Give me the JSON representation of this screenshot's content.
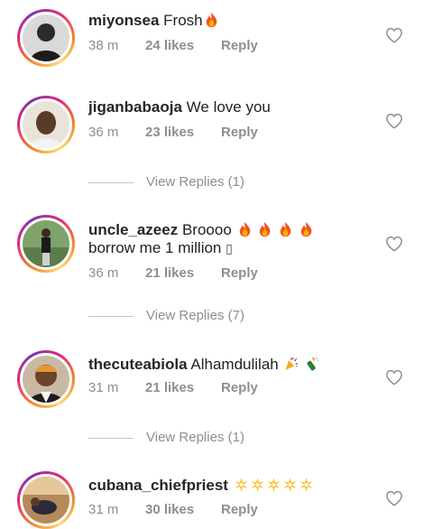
{
  "comments": [
    {
      "username": "miyonsea",
      "text": "Frosh",
      "emoji": [
        "fire"
      ],
      "time": "38 m",
      "likes": "24 likes",
      "reply": "Reply"
    },
    {
      "username": "jiganbabaoja",
      "text": "We love you",
      "time": "36 m",
      "likes": "23 likes",
      "reply": "Reply",
      "view_replies": "View Replies (1)"
    },
    {
      "username": "uncle_azeez",
      "text": "Broooo",
      "emoji": [
        "fire",
        "fire",
        "fire",
        "fire"
      ],
      "text2": "borrow me 1 million",
      "text2_glyph": "▯",
      "time": "36 m",
      "likes": "21 likes",
      "reply": "Reply",
      "view_replies": "View Replies (7)"
    },
    {
      "username": "thecuteabiola",
      "text": "Alhamdulilah",
      "emoji": [
        "party-popper",
        "bottle-with-popping-cork"
      ],
      "time": "31 m",
      "likes": "21 likes",
      "reply": "Reply",
      "view_replies": "View Replies (1)"
    },
    {
      "username": "cubana_chiefpriest",
      "emoji": [
        "sparkler",
        "sparkler",
        "sparkler",
        "sparkler",
        "sparkler"
      ],
      "time": "31 m",
      "likes": "30 likes",
      "reply": "Reply"
    }
  ],
  "colors": {
    "username": "#262626",
    "meta": "#8e8e8e",
    "ring_start": "#f58529",
    "ring_end": "#dd2a7b"
  }
}
